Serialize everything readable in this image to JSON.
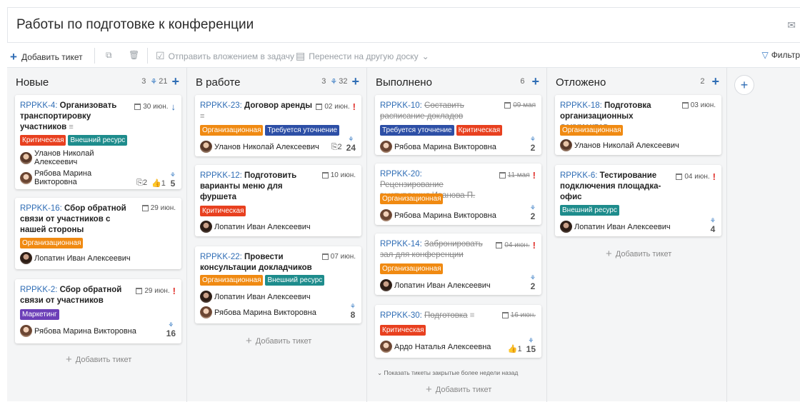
{
  "header": {
    "title": "Работы по подготовке к конференции",
    "mail_icon": "envelope-icon"
  },
  "toolbar": {
    "add_ticket": "Добавить тикет",
    "send_attachment": "Отправить вложением в задачу",
    "move_board": "Перенести на другую доску",
    "filter": "Фильтр"
  },
  "colors": {
    "critical": "#e8401f",
    "external": "#1e8c8c",
    "org": "#f08a12",
    "clarify": "#2d4fa6",
    "marketing": "#6c3fb8",
    "link": "#2f6db5"
  },
  "columns": [
    {
      "name": "Новые",
      "count": "3",
      "points": "21",
      "add_ticket": "Добавить тикет"
    },
    {
      "name": "В работе",
      "count": "3",
      "points": "32",
      "add_ticket": "Добавить тикет"
    },
    {
      "name": "Выполнено",
      "count": "6",
      "show_closed": "Показать тикеты закрытые более недели назад",
      "add_ticket": "Добавить тикет"
    },
    {
      "name": "Отложено",
      "count": "2",
      "add_ticket": "Добавить тикет"
    }
  ],
  "cards": {
    "c1": {
      "key": "RPPKK-4:",
      "title": "Организовать транспортировку участников",
      "date": "30 июн.",
      "tags": [
        "Критическая",
        "Внешний ресурс"
      ],
      "user1": "Уланов Николай Алексеевич",
      "user2": "Рябова Марина Викторовна",
      "attach": "2",
      "likes": "1",
      "points": "5"
    },
    "c2": {
      "key": "RPPKK-16:",
      "title": "Сбор обратной связи от участников с нашей стороны",
      "date": "29 июн.",
      "tags": [
        "Организационная"
      ],
      "user1": "Лопатин Иван Алексеевич"
    },
    "c3": {
      "key": "RPPKK-2:",
      "title": "Сбор обратной связи от участников",
      "date": "29 июн.",
      "tags": [
        "Маркетинг"
      ],
      "user1": "Рябова Марина Викторовна",
      "points": "16"
    },
    "c4": {
      "key": "RPPKK-23:",
      "title": "Договор аренды",
      "date": "02 июн.",
      "tags": [
        "Организационная",
        "Требуется уточнение"
      ],
      "user1": "Уланов Николай Алексеевич",
      "attach": "2",
      "points": "24"
    },
    "c5": {
      "key": "RPPKK-12:",
      "title": "Подготовить варианты меню для фуршета",
      "date": "10 июн.",
      "tags": [
        "Критическая"
      ],
      "user1": "Лопатин Иван Алексеевич"
    },
    "c6": {
      "key": "RPPKK-22:",
      "title": "Провести консультации докладчиков",
      "date": "07 июн.",
      "tags": [
        "Организационная",
        "Внешний ресурс"
      ],
      "user1": "Лопатин Иван Алексеевич",
      "user2": "Рябова Марина Викторовна",
      "points": "8"
    },
    "c7": {
      "key": "RPPKK-10:",
      "title": "Составить расписание докладов",
      "date": "09 мая",
      "tags": [
        "Требуется уточнение",
        "Критическая"
      ],
      "user1": "Рябова Марина Викторовна",
      "points": "2"
    },
    "c8": {
      "key": "RPPKK-20:",
      "title": "Рецензирование выступления Иванова П.",
      "date": "11 мая",
      "tags": [
        "Организационная"
      ],
      "user1": "Рябова Марина Викторовна",
      "points": "2"
    },
    "c9": {
      "key": "RPPKK-14:",
      "title": "Забронировать зал для конференции",
      "date": "04 июн.",
      "tags": [
        "Организационная"
      ],
      "user1": "Лопатин Иван Алексеевич",
      "points": "2"
    },
    "c10": {
      "key": "RPPKK-30:",
      "title": "Подготовка",
      "date": "16 июн.",
      "tags": [
        "Критическая"
      ],
      "user1": "Ардо Наталья Алексеевна",
      "likes": "1",
      "points": "15"
    },
    "c11": {
      "key": "RPPKK-18:",
      "title": "Подготовка организационных документов",
      "date": "03 июн.",
      "tags": [
        "Организационная"
      ],
      "user1": "Уланов Николай Алексеевич"
    },
    "c12": {
      "key": "RPPKK-6:",
      "title": "Тестирование подключения площадка-офис",
      "date": "04 июн.",
      "tags": [
        "Внешний ресурс"
      ],
      "user1": "Лопатин Иван Алексеевич",
      "points": "4"
    }
  }
}
